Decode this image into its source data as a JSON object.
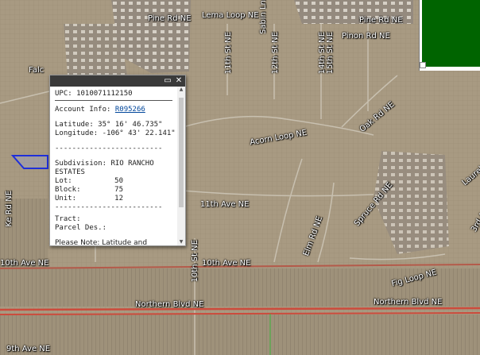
{
  "map": {
    "roads": {
      "pine_rd": "Pine Rd NE",
      "lema_loop": "Lema Loop NE",
      "sabin_ln": "Sabin Ln",
      "pinon_rd": "Pinon Rd NE",
      "pine_rd_2": "Pine Rd NE",
      "street_11th": "11th St NE",
      "street_12th": "12th St NE",
      "street_14th": "14th St NE",
      "street_15th": "15th St NE",
      "oak_rd": "Oak Rd NE",
      "acorn_loop": "Acorn Loop NE",
      "laurel": "Laurel St",
      "ave_11th": "11th Ave NE",
      "street_10th": "10th St NE",
      "spruce_rd": "Spruce Rd NE",
      "elm_rd": "Elm Rd NE",
      "ave_10th_left": "10th Ave NE",
      "ave_10th_mid": "10th Ave NE",
      "fig_loop": "Fig Loop NE",
      "northern_blvd_left": "Northern Blvd NE",
      "northern_blvd_right": "Northern Blvd NE",
      "ave_9th": "9th Ave NE",
      "falcon": "Falc",
      "ke_rd": "Ke Rd NE",
      "ave_3rd": "3rd Ave NE"
    }
  },
  "popup": {
    "upc_label": "UPC: 1010071112150",
    "account_label": "Account Info: ",
    "account_link": "R095266",
    "latitude": "Latitude: 35° 16' 46.735\"",
    "longitude": "Longitude: -106° 43' 22.141\"",
    "separator": "-------------------------",
    "subdivision_label": "Subdivision: RIO RANCHO",
    "subdivision_cont": "ESTATES",
    "lot_label": "Lot:",
    "lot_value": "50",
    "block_label": "Block:",
    "block_value": "75",
    "unit_label": "Unit:",
    "unit_value": "12",
    "tract_label": "Tract:",
    "parcel_label": "Parcel Des.:",
    "note": "Please Note: Latitude and Longitude is the approximate center of the parcel shown."
  }
}
